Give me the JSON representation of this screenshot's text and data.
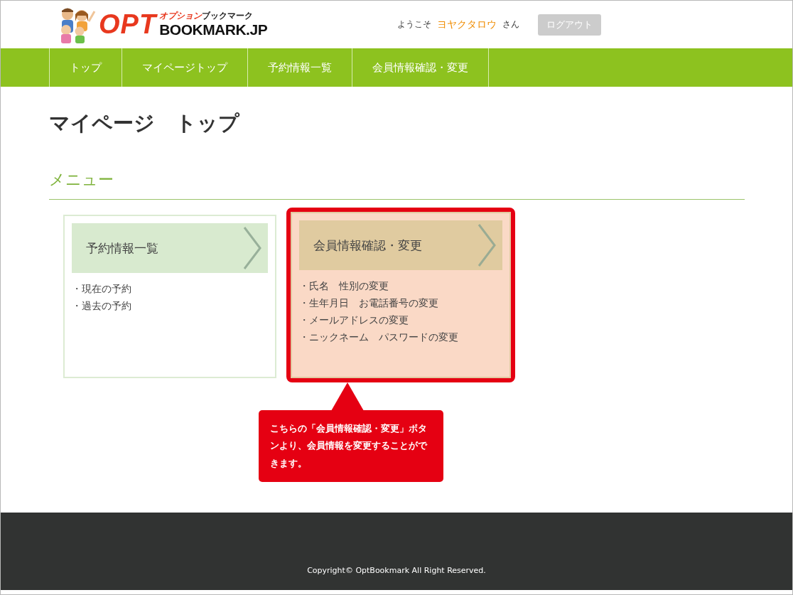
{
  "logo": {
    "mark": "OPT",
    "kana_red": "オプション",
    "kana": "ブックマーク",
    "domain": "BOOKMARK.JP"
  },
  "header": {
    "welcome": "ようこそ",
    "user_name": "ヨヤクタロウ",
    "honorific": "さん",
    "logout_button": "ログアウト"
  },
  "nav": [
    {
      "label": "トップ",
      "selected": false
    },
    {
      "label": "マイページトップ",
      "selected": false
    },
    {
      "label": "予約情報一覧",
      "selected": false
    },
    {
      "label": "会員情報確認・変更",
      "selected": false
    }
  ],
  "page_title": "マイページ　トップ",
  "section_title": "メニュー",
  "cards": [
    {
      "title": "予約情報一覧",
      "highlighted": false,
      "links": [
        "・現在の予約",
        "・過去の予約"
      ]
    },
    {
      "title": "会員情報確認・変更",
      "highlighted": true,
      "links": [
        "・氏名　性別の変更",
        "・生年月日　お電話番号の変更",
        "・メールアドレスの変更",
        "・ニックネーム　パスワードの変更"
      ]
    }
  ],
  "callout": "こちらの「会員情報確認・変更」ボタンより、会員情報を変更することができます。",
  "footer": {
    "copyright": "Copyright© OptBookmark All Right Reserved."
  }
}
